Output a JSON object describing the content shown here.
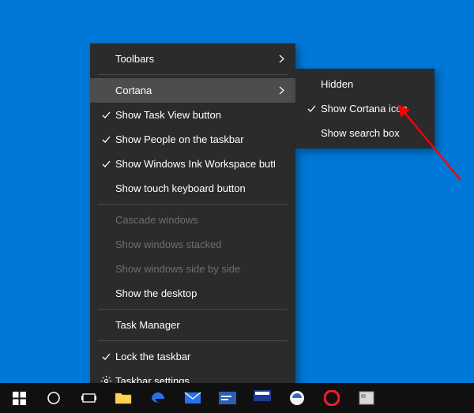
{
  "menu": {
    "items": [
      {
        "label": "Toolbars",
        "submenu": true
      },
      {
        "label": "Cortana",
        "submenu": true,
        "hovered": true
      },
      {
        "label": "Show Task View button",
        "checked": true
      },
      {
        "label": "Show People on the taskbar",
        "checked": true
      },
      {
        "label": "Show Windows Ink Workspace button",
        "checked": true
      },
      {
        "label": "Show touch keyboard button"
      },
      {
        "label": "Cascade windows",
        "disabled": true
      },
      {
        "label": "Show windows stacked",
        "disabled": true
      },
      {
        "label": "Show windows side by side",
        "disabled": true
      },
      {
        "label": "Show the desktop"
      },
      {
        "label": "Task Manager"
      },
      {
        "label": "Lock the taskbar",
        "checked": true
      },
      {
        "label": "Taskbar settings",
        "icon": "gear"
      }
    ],
    "separators_after": [
      0,
      5,
      9,
      10
    ]
  },
  "submenu": {
    "items": [
      {
        "label": "Hidden"
      },
      {
        "label": "Show Cortana icon",
        "checked": true
      },
      {
        "label": "Show search box"
      }
    ]
  },
  "taskbar": {
    "items": [
      {
        "name": "start-button",
        "icon": "windows"
      },
      {
        "name": "cortana-button",
        "icon": "cortana"
      },
      {
        "name": "task-view-button",
        "icon": "taskview"
      },
      {
        "name": "file-explorer",
        "icon": "folder"
      },
      {
        "name": "edge-browser",
        "icon": "edge"
      },
      {
        "name": "mail-app",
        "icon": "mail"
      },
      {
        "name": "app-1",
        "icon": "app1"
      },
      {
        "name": "app-2",
        "icon": "app2"
      },
      {
        "name": "app-3",
        "icon": "app3"
      },
      {
        "name": "opera-browser",
        "icon": "opera"
      },
      {
        "name": "app-4",
        "icon": "app4"
      }
    ]
  }
}
